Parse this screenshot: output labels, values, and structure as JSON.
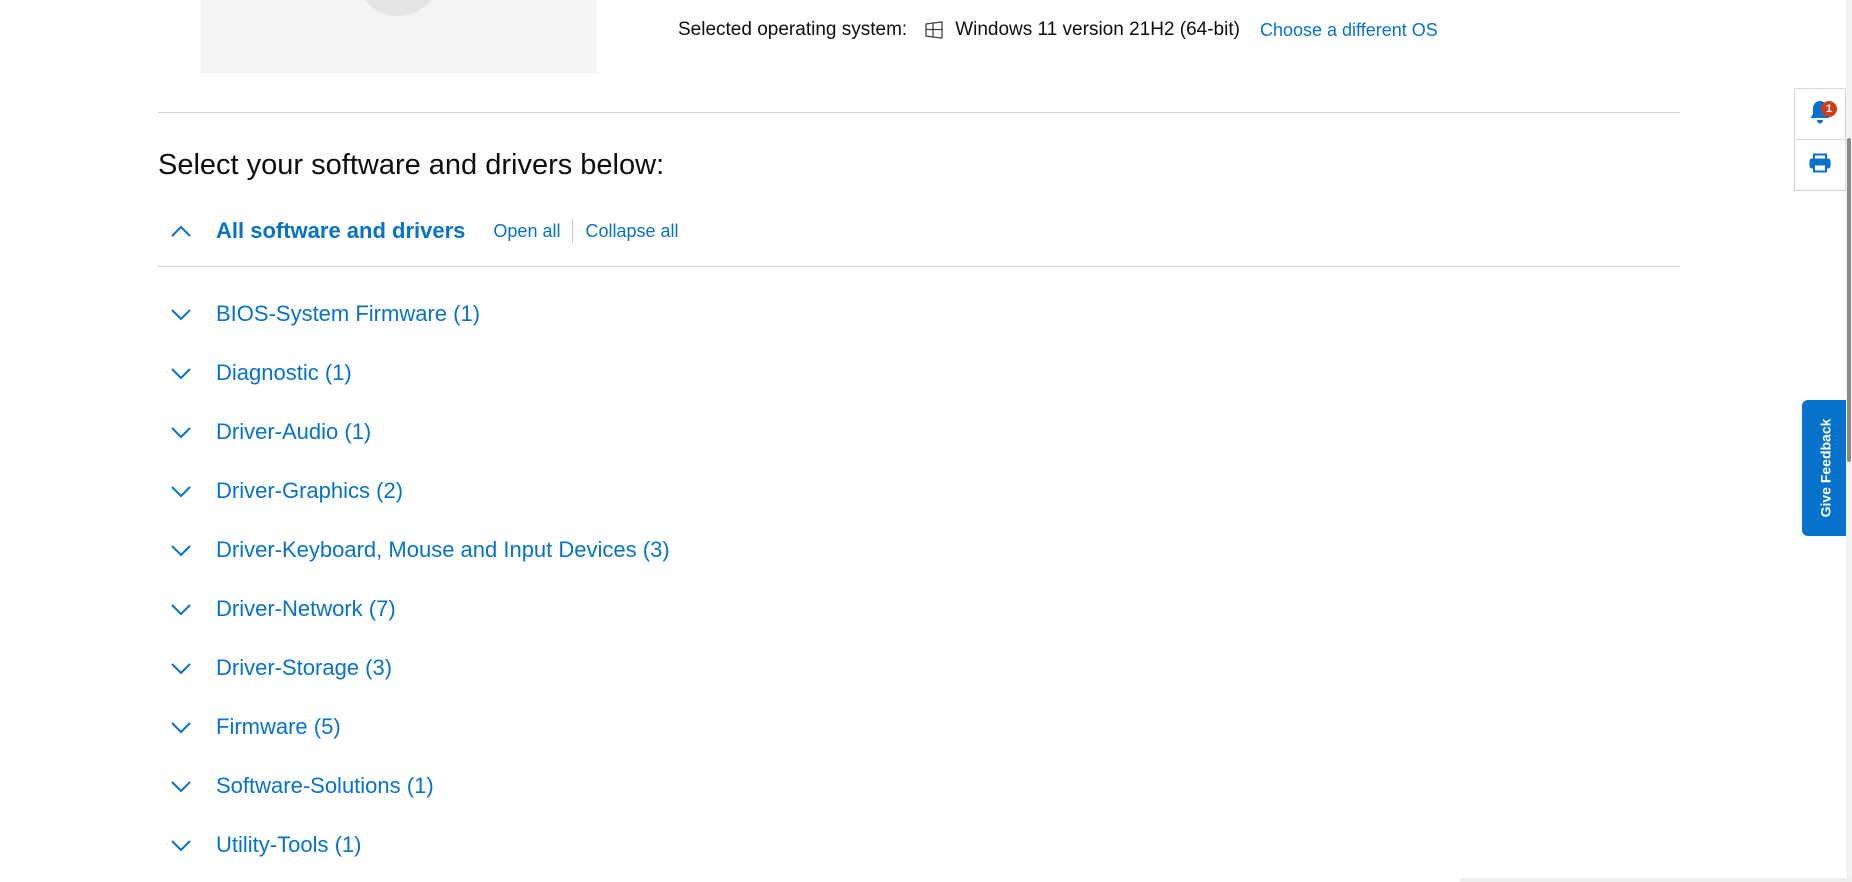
{
  "os": {
    "label": "Selected operating system:",
    "icon": "windows-icon",
    "name": "Windows 11 version 21H2 (64-bit)",
    "change_link": "Choose a different OS"
  },
  "section": {
    "title": "Select your software and drivers below:"
  },
  "all": {
    "title": "All software and drivers",
    "open_all": "Open all",
    "collapse_all": "Collapse all"
  },
  "categories": [
    {
      "label": "BIOS-System Firmware (1)"
    },
    {
      "label": "Diagnostic (1)"
    },
    {
      "label": "Driver-Audio (1)"
    },
    {
      "label": "Driver-Graphics (2)"
    },
    {
      "label": "Driver-Keyboard, Mouse and Input Devices (3)"
    },
    {
      "label": "Driver-Network (7)"
    },
    {
      "label": "Driver-Storage (3)"
    },
    {
      "label": "Firmware (5)"
    },
    {
      "label": "Software-Solutions (1)"
    },
    {
      "label": "Utility-Tools (1)"
    }
  ],
  "tools": {
    "notification_count": "1"
  },
  "feedback": {
    "label": "Give Feedback"
  },
  "colors": {
    "link": "#0672cb",
    "badge": "#cf3e1c",
    "text": "#0e0e0e"
  }
}
